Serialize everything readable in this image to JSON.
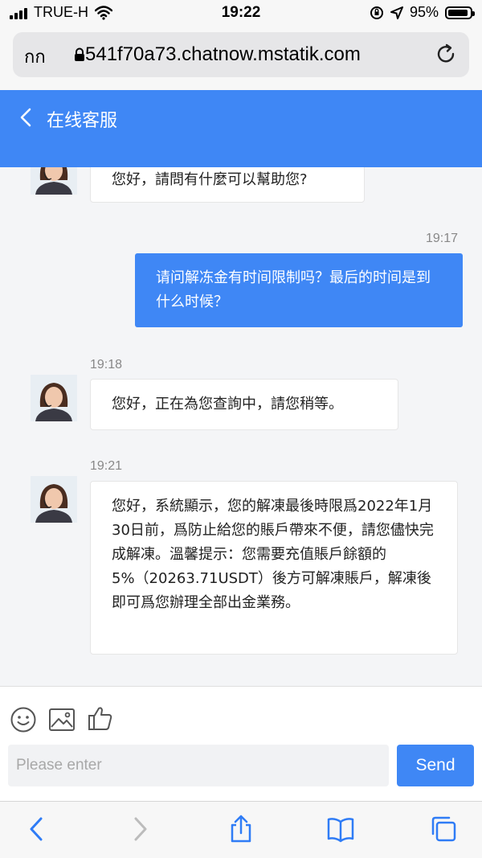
{
  "status_bar": {
    "carrier": "TRUE-H",
    "time": "19:22",
    "battery": "95%"
  },
  "browser": {
    "reader_label": "กก",
    "url": "541f70a73.chatnow.mstatik.com"
  },
  "header": {
    "title": "在线客服"
  },
  "messages": [
    {
      "direction": "in",
      "time": "",
      "text": "您好，請問有什麼可以幫助您?"
    },
    {
      "direction": "out",
      "time": "19:17",
      "text": "请问解冻金有时间限制吗？最后的时间是到什么时候？"
    },
    {
      "direction": "in",
      "time": "19:18",
      "text": "您好，正在為您查詢中，請您稍等。"
    },
    {
      "direction": "in",
      "time": "19:21",
      "text": "您好，系統顯示，您的解凍最後時限爲2022年1月30日前，爲防止給您的賬戶帶來不便，請您儘快完成解凍。溫馨提示：您需要充值賬戶餘額的5%（20263.71USDT）後方可解凍賬戶，解凍後即可爲您辦理全部出金業務。"
    }
  ],
  "composer": {
    "placeholder": "Please enter",
    "send_label": "Send"
  },
  "colors": {
    "accent": "#3f87f5",
    "background": "#f4f5f7"
  },
  "icons": [
    "smiley-icon",
    "image-icon",
    "thumbs-up-icon",
    "back-arrow-icon",
    "forward-arrow-icon",
    "share-icon",
    "bookmarks-icon",
    "tabs-icon",
    "lock-icon",
    "reload-icon"
  ]
}
